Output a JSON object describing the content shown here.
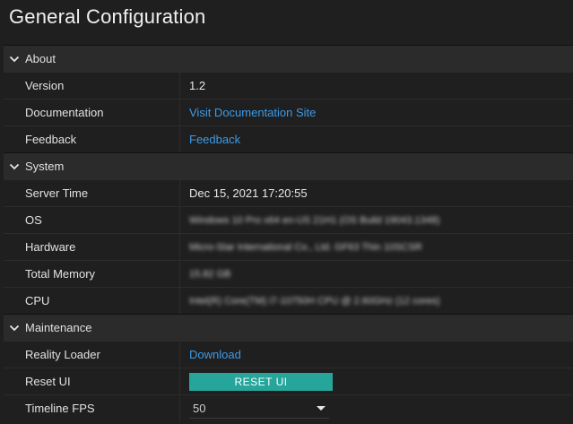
{
  "page_title": "General Configuration",
  "sections": {
    "about": {
      "header": "About",
      "version_label": "Version",
      "version_value": "1.2",
      "documentation_label": "Documentation",
      "documentation_link": "Visit Documentation Site",
      "feedback_label": "Feedback",
      "feedback_link": "Feedback"
    },
    "system": {
      "header": "System",
      "server_time_label": "Server Time",
      "server_time_value": "Dec 15, 2021 17:20:55",
      "os_label": "OS",
      "os_value": "Windows 10 Pro x64 en-US 21H1 (OS Build 19043.1348)",
      "hardware_label": "Hardware",
      "hardware_value": "Micro-Star International Co., Ltd. GF63 Thin 10SCSR",
      "total_memory_label": "Total Memory",
      "total_memory_value": "15.82 GB",
      "cpu_label": "CPU",
      "cpu_value": "Intel(R) Core(TM) i7-10750H CPU @ 2.60GHz (12 cores)"
    },
    "maintenance": {
      "header": "Maintenance",
      "reality_loader_label": "Reality Loader",
      "reality_loader_link": "Download",
      "reset_ui_label": "Reset UI",
      "reset_ui_button": "RESET UI",
      "timeline_fps_label": "Timeline FPS",
      "timeline_fps_value": "50"
    }
  },
  "colors": {
    "background": "#1f1f1f",
    "section_header": "#2b2b2b",
    "link": "#3d9be9",
    "accent_button": "#26a69a"
  },
  "icons": {
    "section_toggle": "chevron-down-icon",
    "select_caret": "caret-down-icon"
  }
}
